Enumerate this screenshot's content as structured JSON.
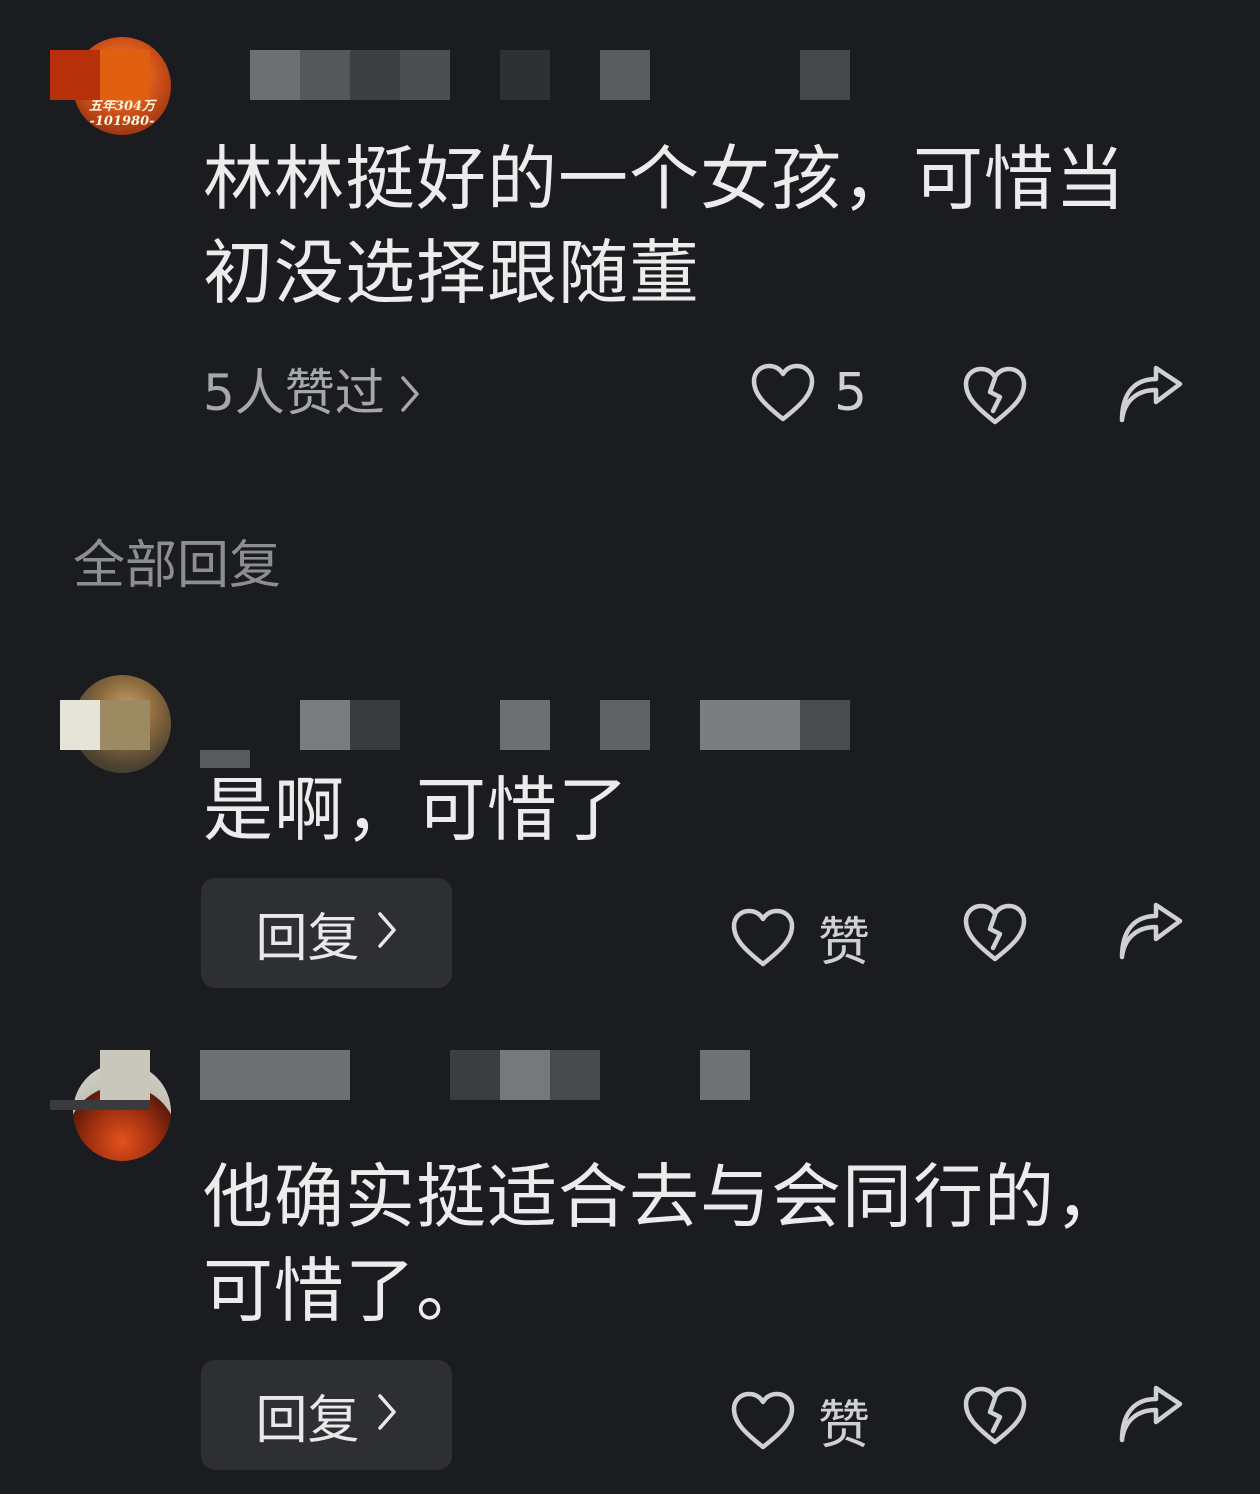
{
  "main_comment": {
    "avatar_text_line1": "五年304万",
    "avatar_text_line2": "-101980-",
    "text_line1": "林林挺好的一个女孩，可惜当",
    "text_line2": "初没选择跟随董",
    "likers_label": "5人赞过",
    "like_count": "5"
  },
  "section_title": "全部回复",
  "replies": [
    {
      "text": "是啊，可惜了",
      "reply_label": "回复",
      "like_label": "赞"
    },
    {
      "text_line1": "他确实挺适合去与会同行的，",
      "text_line2": "可惜了。",
      "reply_label": "回复",
      "like_label": "赞"
    }
  ],
  "colors": {
    "background": "#1b1c1f",
    "text_primary": "#ececed",
    "text_secondary": "#a6a7aa",
    "button_bg": "#2e2f33"
  },
  "icons": [
    "heart-icon",
    "broken-heart-icon",
    "share-icon",
    "chevron-right-icon"
  ]
}
